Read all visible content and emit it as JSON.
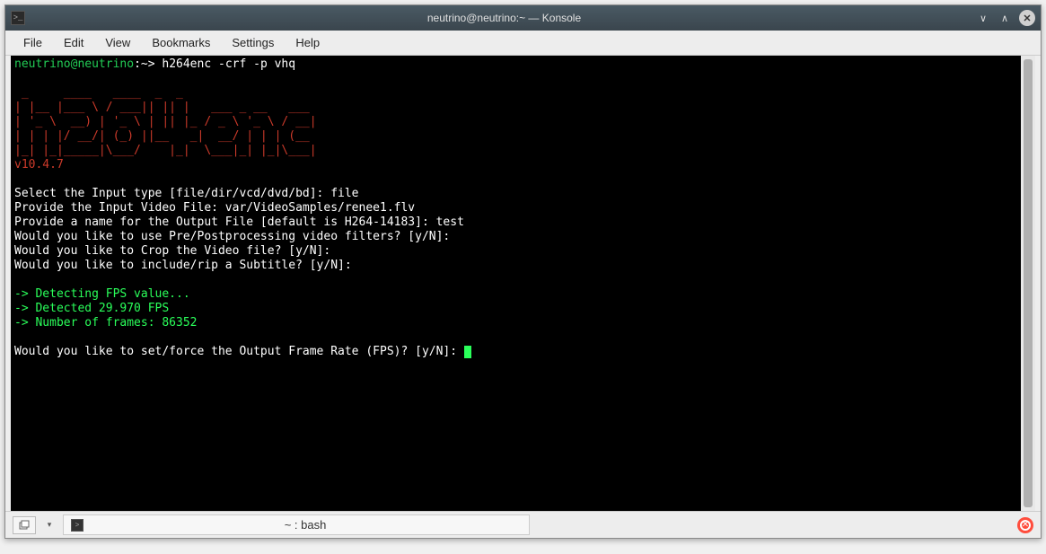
{
  "titlebar": {
    "title": "neutrino@neutrino:~ — Konsole"
  },
  "menubar": {
    "items": [
      "File",
      "Edit",
      "View",
      "Bookmarks",
      "Settings",
      "Help"
    ]
  },
  "terminal": {
    "prompt_user": "neutrino@neutrino",
    "prompt_path": ":~> ",
    "command": "h264enc -crf -p vhq",
    "ascii_art": [
      " _     ____   ____  _  _",
      "| |__ |___ \\ / ___|| || |   ___ _ __   ___",
      "| '_ \\  __) | '_ \\ | || |_ / _ \\ '_ \\ / __|",
      "| | | |/ __/| (_) ||__   _|  __/ | | | (__",
      "|_| |_|_____|\\___/    |_|  \\___|_| |_|\\___|"
    ],
    "version": "v10.4.7",
    "line_input_type": "Select the Input type [file/dir/vcd/dvd/bd]: file",
    "line_input_file": "Provide the Input Video File: var/VideoSamples/renee1.flv",
    "line_output_name": "Provide a name for the Output File [default is H264-14183]: test",
    "line_filters": "Would you like to use Pre/Postprocessing video filters? [y/N]:",
    "line_crop": "Would you like to Crop the Video file? [y/N]:",
    "line_subtitle": "Would you like to include/rip a Subtitle? [y/N]:",
    "line_detecting": "-> Detecting FPS value...",
    "line_detected": "-> Detected 29.970 FPS",
    "line_numframes": "-> Number of frames: 86352",
    "line_setforce": "Would you like to set/force the Output Frame Rate (FPS)? [y/N]: "
  },
  "statusbar": {
    "tab_label": "~ : bash"
  }
}
